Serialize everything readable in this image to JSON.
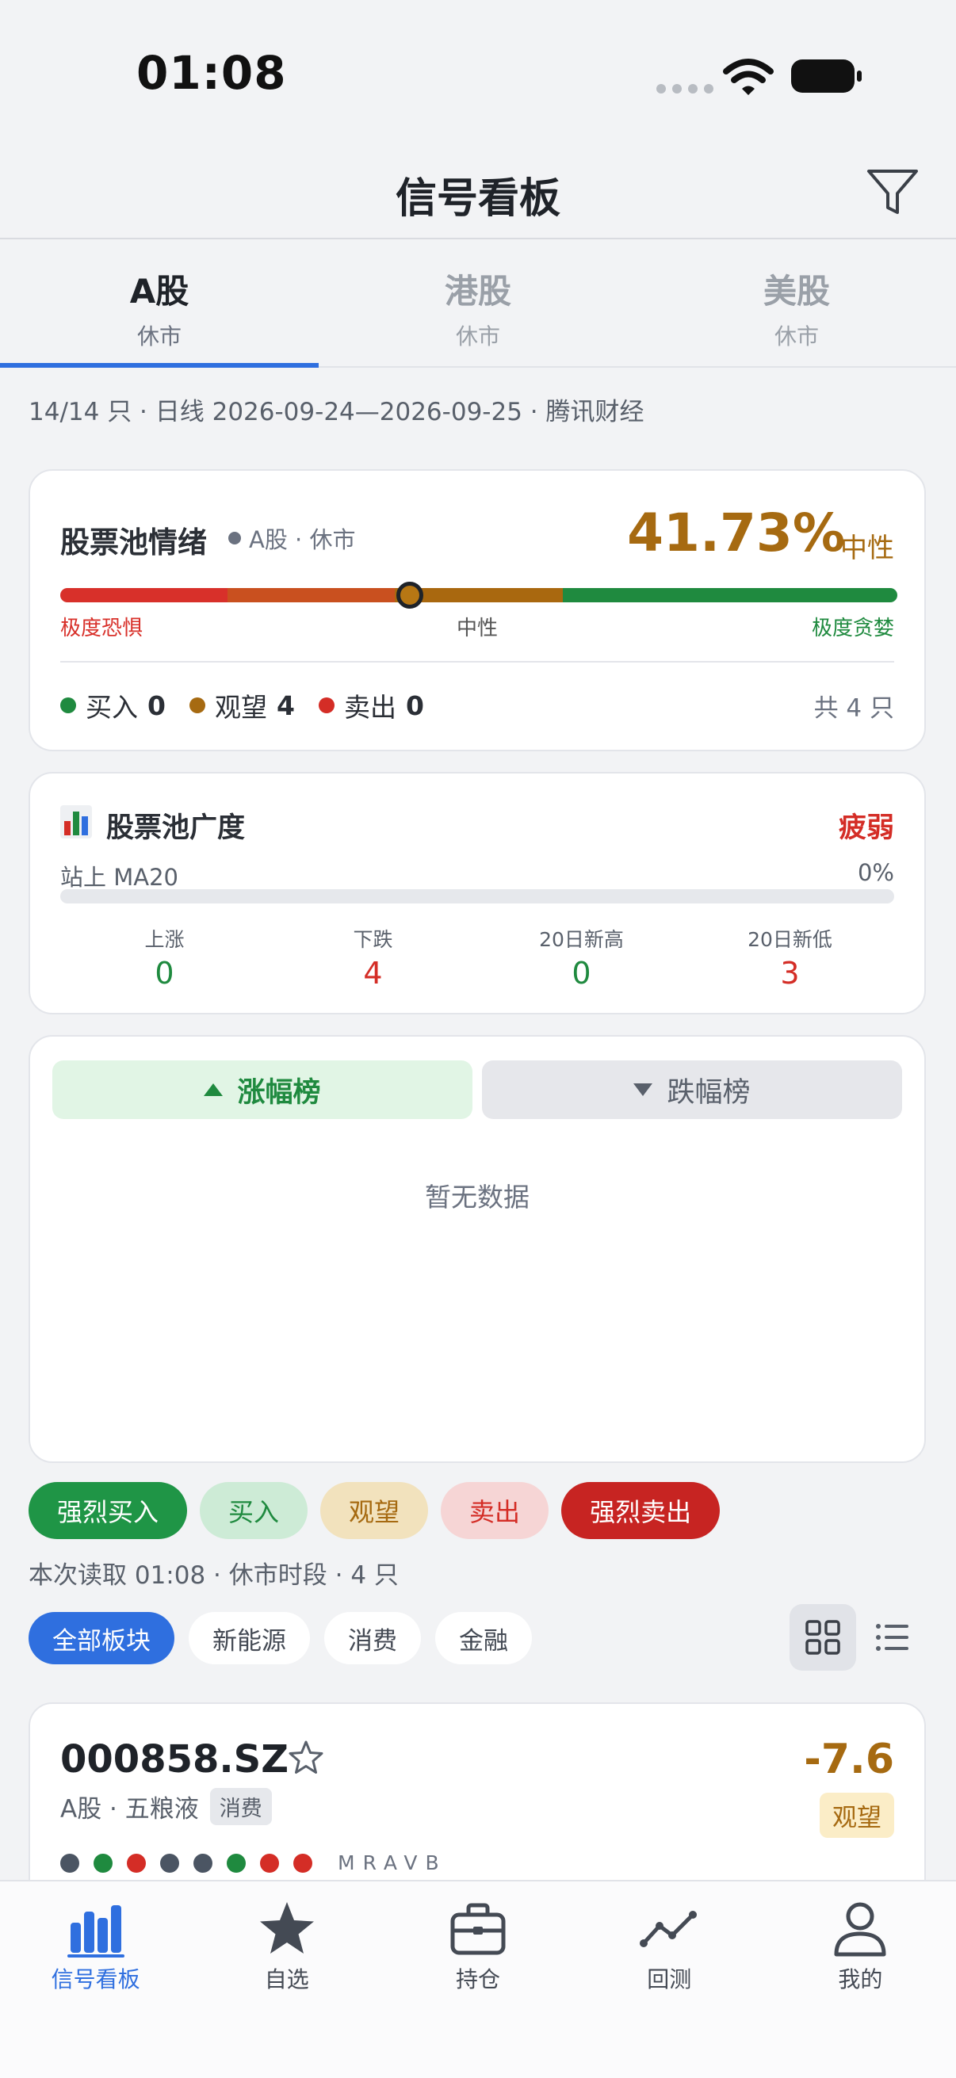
{
  "status_bar": {
    "time": "01:08"
  },
  "navbar": {
    "title": "信号看板",
    "filter_icon": "filter-icon"
  },
  "market_tabs": [
    {
      "name": "A股",
      "status": "休市",
      "active": true
    },
    {
      "name": "港股",
      "status": "休市",
      "active": false
    },
    {
      "name": "美股",
      "status": "休市",
      "active": false
    }
  ],
  "meta_line": "14/14 只 · 日线 2026-09-24—2026-09-25 · 腾讯财经",
  "sentiment": {
    "title": "股票池情绪",
    "tag": "A股 · 休市",
    "percent": "41.73%",
    "level": "中性",
    "scale_fraction": 0.4173,
    "labels": {
      "left": "极度恐惧",
      "middle": "中性",
      "right": "极度贪婪"
    },
    "counts": [
      {
        "label": "买入",
        "value": "0",
        "color": "#1f8a3f"
      },
      {
        "label": "观望",
        "value": "4",
        "color": "#a66a11"
      },
      {
        "label": "卖出",
        "value": "0",
        "color": "#d42d26"
      }
    ],
    "total": "共 4 只"
  },
  "breadth": {
    "title": "股票池广度",
    "status": "疲弱",
    "ma_label": "站上 MA20",
    "ma_pct": "0%",
    "ma_fraction": 0,
    "stats": [
      {
        "label": "上涨",
        "value": "0",
        "tone": "green"
      },
      {
        "label": "下跌",
        "value": "4",
        "tone": "red"
      },
      {
        "label": "20日新高",
        "value": "0",
        "tone": "green"
      },
      {
        "label": "20日新低",
        "value": "3",
        "tone": "red"
      }
    ]
  },
  "ranking": {
    "up_label": "涨幅榜",
    "down_label": "跌幅榜",
    "empty_text": "暂无数据"
  },
  "signal_filters": [
    "强烈买入",
    "买入",
    "观望",
    "卖出",
    "强烈卖出"
  ],
  "read_line": "本次读取 01:08 · 休市时段 · 4 只",
  "sectors": [
    "全部板块",
    "新能源",
    "消费",
    "金融"
  ],
  "stock": {
    "code": "000858.SZ",
    "market_name": "A股 · 五粮液",
    "sector_tag": "消费",
    "score": "-7.6",
    "signal": "观望",
    "indicator_colors": [
      "#4b5563",
      "#1f8a3f",
      "#d42d26",
      "#4b5563",
      "#4b5563",
      "#1f8a3f",
      "#d42d26",
      "#d42d26"
    ],
    "indicator_letters": "MRAVB"
  },
  "tabbar": [
    {
      "label": "信号看板",
      "icon": "bar-chart-icon",
      "active": true
    },
    {
      "label": "自选",
      "icon": "star-icon",
      "active": false
    },
    {
      "label": "持仓",
      "icon": "briefcase-icon",
      "active": false
    },
    {
      "label": "回测",
      "icon": "line-chart-icon",
      "active": false
    },
    {
      "label": "我的",
      "icon": "person-icon",
      "active": false
    }
  ],
  "colors": {
    "accent": "#2f6fdf",
    "buy": "#1f8a3f",
    "watch": "#a66a11",
    "sell": "#d42d26"
  }
}
